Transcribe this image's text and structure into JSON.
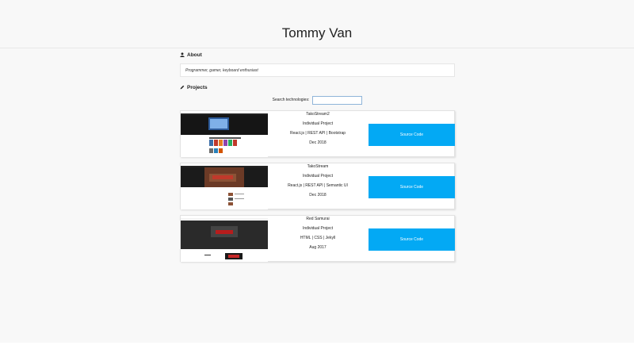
{
  "header": {
    "title": "Tommy Van"
  },
  "about": {
    "heading": "About",
    "text": "Programmer, gamer, keyboard enthusiast"
  },
  "projects": {
    "heading": "Projects",
    "search_label": "Search technologies:",
    "search_value": "",
    "items": [
      {
        "name": "TakoStream2",
        "type": "Individual Project",
        "tech": "React.js | REST API | Bootstrap",
        "date": "Dec 2018",
        "button": "Source Code"
      },
      {
        "name": "TakoStream",
        "type": "Individual Project",
        "tech": "React.js | REST API | Semantic UI",
        "date": "Dec 2018",
        "button": "Source Code"
      },
      {
        "name": "Red Samurai",
        "type": "Individual Project",
        "tech": "HTML | CSS | Jekyll",
        "date": "Aug 2017",
        "button": "Source Code"
      }
    ]
  },
  "colors": {
    "accent": "#03a9f4",
    "background": "#f8f8f8"
  },
  "icons": {
    "about": "user-icon",
    "projects": "pencil-icon"
  }
}
